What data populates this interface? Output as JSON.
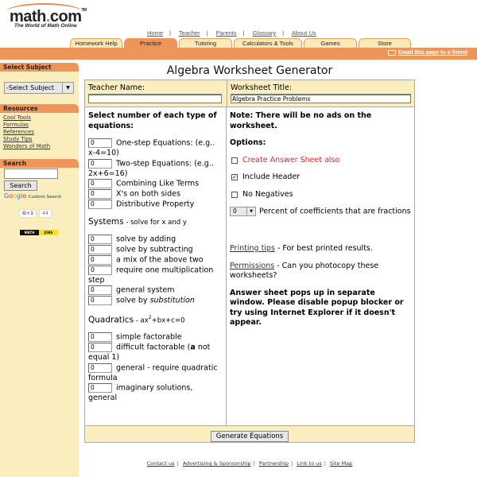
{
  "brand": {
    "name_prefix": "math",
    "name_dot": ".",
    "name_suffix": "com",
    "tm": "TM",
    "tagline": "The World of Math Online"
  },
  "top_links": [
    "Home",
    "Teacher",
    "Parents",
    "Glossary",
    "About Us"
  ],
  "tabs": [
    {
      "label": "Homework Help",
      "active": false
    },
    {
      "label": "Practice",
      "active": true
    },
    {
      "label": "Tutoring",
      "active": false
    },
    {
      "label": "Calculators & Tools",
      "active": false
    },
    {
      "label": "Games",
      "active": false
    },
    {
      "label": "Store",
      "active": false
    }
  ],
  "email_link": "Email this page to a friend",
  "sidebar": {
    "select_subject_heading": "Select Subject",
    "select_subject_value": "-Select Subject",
    "resources_heading": "Resources",
    "resources": [
      "Cool Tools",
      "Formulas",
      "References",
      "Study Tips",
      "Wonders of Math"
    ],
    "search_heading": "Search",
    "search_button": "Search",
    "custom_search": "Custom Search",
    "gplus_label": "G+1",
    "gplus_count": "44",
    "mathjobs_left": "MATH",
    "mathjobs_right": "JOBS"
  },
  "main": {
    "title": "Algebra Worksheet Generator",
    "teacher_name_label": "Teacher Name:",
    "teacher_name_value": "",
    "worksheet_title_label": "Worksheet Title:",
    "worksheet_title_value": "Algebra Practice Problems",
    "select_instructions": "Select number of each type of equations:",
    "basic": [
      {
        "value": "0",
        "label": "One-step Equations: (e.g.. x-4=10)"
      },
      {
        "value": "0",
        "label": "Two-step Equations: (e.g.. 2x+6=16)"
      },
      {
        "value": "0",
        "label": "Combining Like Terms"
      },
      {
        "value": "0",
        "label": "X's on both sides"
      },
      {
        "value": "0",
        "label": "Distributive Property"
      }
    ],
    "systems_heading": "Systems",
    "systems_sub": " - solve for x and y",
    "systems": [
      {
        "value": "0",
        "label": "solve by adding"
      },
      {
        "value": "0",
        "label": "solve by subtracting"
      },
      {
        "value": "0",
        "label": "a mix of the above two"
      },
      {
        "value": "0",
        "label": "require one multiplication step"
      },
      {
        "value": "0",
        "label": "general system"
      },
      {
        "value": "0",
        "label_pre": "solve by ",
        "label_em": "substitution"
      }
    ],
    "quadratics_heading": "Quadratics",
    "quadratics_sub_pre": " - ax",
    "quadratics_sup": "2",
    "quadratics_sub_post": "+bx+c=0",
    "quadratics": [
      {
        "value": "0",
        "label": "simple factorable"
      },
      {
        "value": "0",
        "label_pre": "difficult factorable (",
        "label_b": "a",
        "label_post": " not equal 1)"
      },
      {
        "value": "0",
        "label": "general - require quadratic formula"
      },
      {
        "value": "0",
        "label": "imaginary solutions, general"
      }
    ],
    "note": "Note: There will be no ads on the worksheet.",
    "options_heading": "Options:",
    "options": [
      {
        "label": "Create Answer Sheet also",
        "checked": false,
        "mark": ""
      },
      {
        "label": "Include Header",
        "checked": true,
        "mark": "✓"
      },
      {
        "label": "No Negatives",
        "checked": false,
        "mark": ""
      }
    ],
    "percent_value": "0",
    "percent_label": "Percent of coefficients that are fractions",
    "printing_tips_link": "Printing tips",
    "printing_tips_text": " - For best printed results.",
    "permissions_link": "Permissions",
    "permissions_text": " - Can you photocopy these worksheets?",
    "popup_note": "Answer sheet pops up in separate window. Please disable popup blocker or try using Internet Explorer if it doesn't appear.",
    "generate_button": "Generate Equations"
  },
  "footer_links": [
    "Contact us",
    "Advertising & Sponsorship",
    "Partnership",
    "Link to us",
    "Site Map"
  ],
  "colors": {
    "orange": "#f0955a",
    "cream": "#fbeebe",
    "red_text": "#e0282b"
  }
}
